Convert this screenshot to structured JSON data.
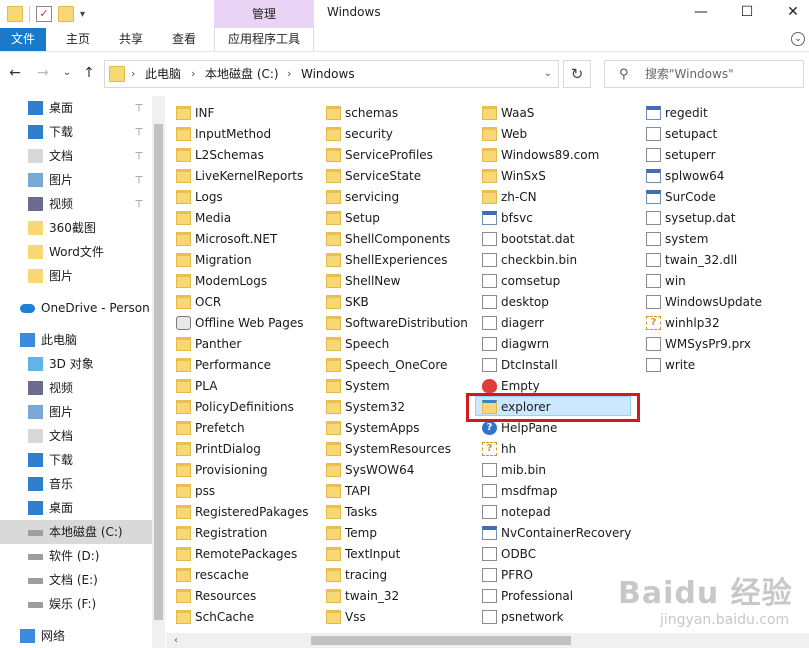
{
  "window": {
    "title": "Windows",
    "manage_tab": "管理",
    "min": "—",
    "max": "☐",
    "close": "✕"
  },
  "ribbon": {
    "tabs": [
      "文件",
      "主页",
      "共享",
      "查看",
      "应用程序工具"
    ],
    "expand": "⌄"
  },
  "nav": {
    "back": "←",
    "forward": "→",
    "recent": "⌄",
    "up": "↑",
    "refresh": "↻"
  },
  "address": {
    "crumbs": [
      "此电脑",
      "本地磁盘 (C:)",
      "Windows"
    ],
    "sep": "›",
    "dropdown": "⌄"
  },
  "search": {
    "placeholder": "搜索\"Windows\"",
    "icon": "⚲"
  },
  "sidebar": {
    "items": [
      {
        "label": "桌面",
        "icon": "desktop-icon",
        "pin": true
      },
      {
        "label": "下载",
        "icon": "download-icon",
        "pin": true
      },
      {
        "label": "文档",
        "icon": "document-icon",
        "pin": true
      },
      {
        "label": "图片",
        "icon": "picture-icon",
        "pin": true
      },
      {
        "label": "视频",
        "icon": "video-icon",
        "pin": true
      },
      {
        "label": "360截图",
        "icon": "folder-icon",
        "pin": false
      },
      {
        "label": "Word文件",
        "icon": "folder-icon",
        "pin": false
      },
      {
        "label": "图片",
        "icon": "folder-icon",
        "pin": false
      },
      {
        "label": "OneDrive - Person",
        "icon": "onedrive-icon",
        "pin": false
      },
      {
        "label": "此电脑",
        "icon": "computer-icon",
        "pin": false
      },
      {
        "label": "3D 对象",
        "icon": "cube-icon",
        "pin": false
      },
      {
        "label": "视频",
        "icon": "video-icon",
        "pin": false
      },
      {
        "label": "图片",
        "icon": "picture-icon",
        "pin": false
      },
      {
        "label": "文档",
        "icon": "document-icon",
        "pin": false
      },
      {
        "label": "下载",
        "icon": "download-icon",
        "pin": false
      },
      {
        "label": "音乐",
        "icon": "music-icon",
        "pin": false
      },
      {
        "label": "桌面",
        "icon": "desktop-icon",
        "pin": false
      },
      {
        "label": "本地磁盘 (C:)",
        "icon": "drive-icon",
        "pin": false,
        "selected": true
      },
      {
        "label": "软件 (D:)",
        "icon": "drive-icon",
        "pin": false
      },
      {
        "label": "文档 (E:)",
        "icon": "drive-icon",
        "pin": false
      },
      {
        "label": "娱乐 (F:)",
        "icon": "drive-icon",
        "pin": false
      },
      {
        "label": "网络",
        "icon": "network-icon",
        "pin": false
      }
    ],
    "pin_glyph": "📌"
  },
  "files": {
    "columns": [
      [
        "INF",
        "InputMethod",
        "L2Schemas",
        "LiveKernelReports",
        "Logs",
        "Media",
        "Microsoft.NET",
        "Migration",
        "ModemLogs",
        "OCR",
        "Offline Web Pages",
        "Panther",
        "Performance",
        "PLA",
        "PolicyDefinitions",
        "Prefetch",
        "PrintDialog",
        "Provisioning",
        "pss",
        "RegisteredPakages",
        "Registration",
        "RemotePackages",
        "rescache",
        "Resources",
        "SchCache"
      ],
      [
        "schemas",
        "security",
        "ServiceProfiles",
        "ServiceState",
        "servicing",
        "Setup",
        "ShellComponents",
        "ShellExperiences",
        "ShellNew",
        "SKB",
        "SoftwareDistribution",
        "Speech",
        "Speech_OneCore",
        "System",
        "System32",
        "SystemApps",
        "SystemResources",
        "SysWOW64",
        "TAPI",
        "Tasks",
        "Temp",
        "TextInput",
        "tracing",
        "twain_32",
        "Vss"
      ],
      [
        "WaaS",
        "Web",
        "Windows89.com",
        "WinSxS",
        "zh-CN",
        "bfsvc",
        "bootstat.dat",
        "checkbin.bin",
        "comsetup",
        "desktop",
        "diagerr",
        "diagwrn",
        "DtcInstall",
        "Empty",
        "explorer",
        "HelpPane",
        "hh",
        "mib.bin",
        "msdfmap",
        "notepad",
        "NvContainerRecovery",
        "ODBC",
        "PFRO",
        "Professional",
        "psnetwork"
      ],
      [
        "regedit",
        "setupact",
        "setuperr",
        "splwow64",
        "SurCode",
        "sysetup.dat",
        "system",
        "twain_32.dll",
        "win",
        "WindowsUpdate",
        "winhlp32",
        "WMSysPr9.prx",
        "write"
      ]
    ],
    "types": [
      [
        "folder",
        "folder",
        "folder",
        "folder",
        "folder",
        "folder",
        "folder",
        "folder",
        "folder",
        "folder",
        "web-folder",
        "folder",
        "folder",
        "folder",
        "folder",
        "folder",
        "folder",
        "folder",
        "folder",
        "folder",
        "folder",
        "folder",
        "folder",
        "folder",
        "folder"
      ],
      [
        "folder",
        "folder",
        "folder",
        "folder",
        "folder",
        "folder",
        "folder",
        "folder",
        "folder",
        "folder",
        "folder",
        "folder",
        "folder",
        "folder",
        "folder",
        "folder",
        "folder",
        "folder",
        "folder",
        "folder",
        "folder",
        "folder",
        "folder",
        "folder",
        "folder"
      ],
      [
        "folder",
        "folder",
        "folder",
        "folder",
        "folder",
        "exe",
        "doc",
        "doc",
        "doc",
        "doc",
        "doc",
        "doc",
        "doc",
        "empty",
        "explorer",
        "help",
        "help-doc",
        "doc",
        "doc",
        "notepad",
        "exe",
        "doc",
        "doc",
        "doc",
        "doc"
      ],
      [
        "regedit",
        "doc",
        "doc",
        "exe",
        "exe",
        "doc",
        "doc",
        "doc",
        "doc",
        "doc",
        "help-doc",
        "doc",
        "write"
      ]
    ],
    "selected": "explorer"
  },
  "watermark": {
    "line1": "Baidu 经验",
    "line2": "jingyan.baidu.com"
  },
  "scroll": {
    "left_arrow": "‹"
  }
}
